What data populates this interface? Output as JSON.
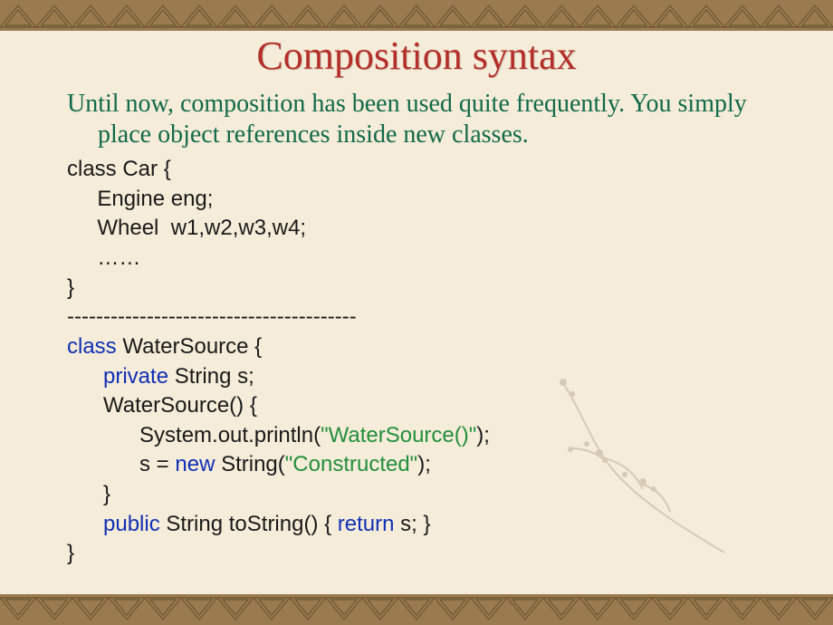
{
  "title": "Composition syntax",
  "intro": "Until now, composition has been used quite frequently. You simply place object references inside new classes.",
  "code": {
    "car": {
      "line1": "class Car {",
      "line2": "     Engine eng;",
      "line3": "     Wheel  w1,w2,w3,w4;",
      "line4": "     ……",
      "line5": "}"
    },
    "sep": "----------------------------------------",
    "ws": {
      "kw_class": "class",
      "class_rest": " WaterSource {",
      "kw_private": "      private",
      "private_rest": " String s;",
      "ctor_open": "      WaterSource() {",
      "println_a": "            System.out.println(",
      "println_str": "\"WaterSource()\"",
      "println_b": ");",
      "assign_a": "            s = ",
      "kw_new": "new",
      "assign_b": " String(",
      "assign_str": "\"Constructed\"",
      "assign_c": ");",
      "ctor_close": "      }",
      "kw_public": "      public",
      "tostr_a": " String toString() { ",
      "kw_return": "return",
      "tostr_b": " s; }",
      "class_close": "}"
    }
  }
}
